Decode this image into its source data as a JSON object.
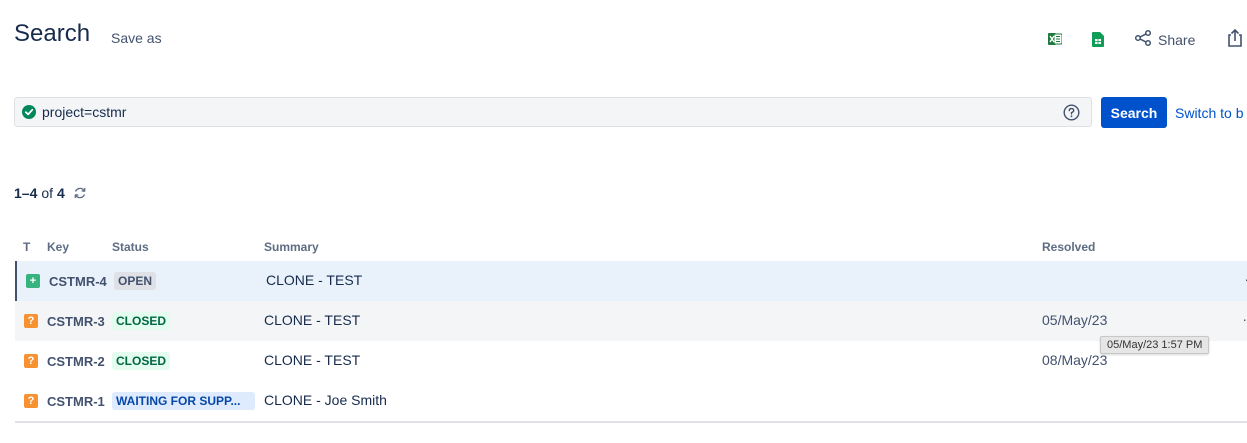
{
  "header": {
    "title": "Search",
    "save_as": "Save as",
    "share_label": "Share",
    "icons": [
      "excel-csv-icon",
      "google-sheets-icon",
      "share-icon",
      "export-icon"
    ],
    "colors": {
      "excel": "#1d7a3e",
      "sheets": "#0f9d58"
    }
  },
  "jql": {
    "query": "project=cstmr",
    "valid_icon": "check-circle-icon",
    "help_icon": "question-circle-icon",
    "search_button": "Search",
    "switch_link": "Switch to b"
  },
  "results": {
    "range": "1–4",
    "of_label": "of",
    "total": "4"
  },
  "table": {
    "columns": {
      "type": "T",
      "key": "Key",
      "status": "Status",
      "summary": "Summary",
      "resolved": "Resolved"
    },
    "rows": [
      {
        "type": "new-feature",
        "key": "CSTMR-4",
        "status": "OPEN",
        "summary": "CLONE - TEST",
        "resolved": ""
      },
      {
        "type": "question",
        "key": "CSTMR-3",
        "status": "CLOSED",
        "summary": "CLONE - TEST",
        "resolved": "05/May/23"
      },
      {
        "type": "question",
        "key": "CSTMR-2",
        "status": "CLOSED",
        "summary": "CLONE - TEST",
        "resolved": "08/May/23"
      },
      {
        "type": "question",
        "key": "CSTMR-1",
        "status": "WAITING FOR SUPP...",
        "summary": "CLONE - Joe Smith",
        "resolved": ""
      }
    ]
  },
  "tooltip": {
    "text": "05/May/23 1:57 PM"
  },
  "colors": {
    "primary": "#0052cc",
    "open_lozenge": "#dfe1e6",
    "closed_lozenge": "#e3fcef",
    "waiting_lozenge": "#deebff",
    "question_type": "#f79232",
    "new_type": "#36b37e"
  }
}
